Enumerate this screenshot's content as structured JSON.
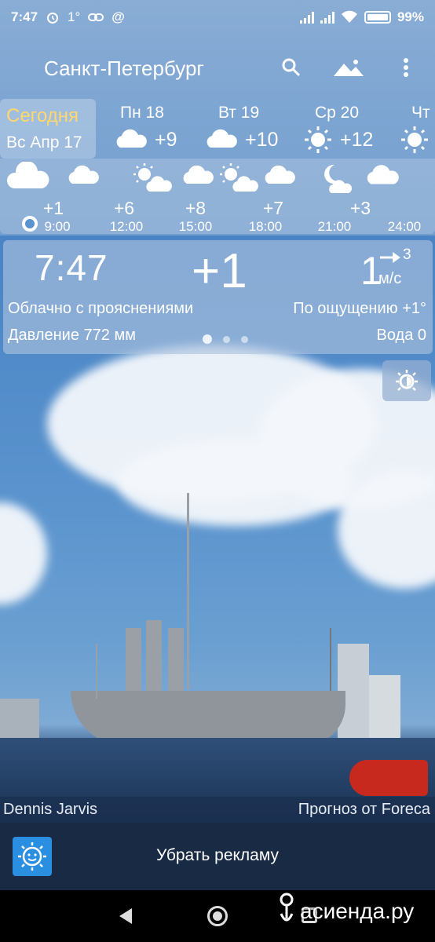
{
  "status_bar": {
    "time": "7:47",
    "notif_temp": "1°",
    "battery": "99%"
  },
  "toolbar": {
    "city": "Санкт-Петербург"
  },
  "daily": {
    "today_label": "Сегодня",
    "today_date": "Вс Апр 17",
    "days": [
      {
        "name": "Пн 18",
        "temp": "+9",
        "icon": "cloud-icon"
      },
      {
        "name": "Вт 19",
        "temp": "+10",
        "icon": "cloud-icon"
      },
      {
        "name": "Ср 20",
        "temp": "+12",
        "icon": "sun-icon"
      },
      {
        "name": "Чт",
        "temp": "",
        "icon": "sun-icon"
      }
    ]
  },
  "hourly": [
    {
      "temp": "+1",
      "time": "9:00",
      "icon": "cloud-icon"
    },
    {
      "temp": "+6",
      "time": "12:00",
      "icon": "partly-cloudy-icon"
    },
    {
      "temp": "+8",
      "time": "15:00",
      "icon": "partly-cloudy-icon"
    },
    {
      "temp": "+7",
      "time": "18:00",
      "icon": "cloud-icon"
    },
    {
      "temp": "+3",
      "time": "21:00",
      "icon": "moon-cloud-icon"
    },
    {
      "temp": "",
      "time": "24:00",
      "icon": "cloud-icon"
    }
  ],
  "current": {
    "time": "7:47",
    "temp": "+1",
    "wind_speed": "1",
    "wind_gust": "3",
    "wind_unit": "м/с",
    "description": "Облачно с прояснениями",
    "feels_like": "По ощущению +1°",
    "pressure": "Давление 772 мм",
    "water": "Вода 0"
  },
  "credits": {
    "photo_author": "Dennis Jarvis",
    "provider": "Прогноз от Foreca"
  },
  "ad": {
    "label": "Убрать рекламу"
  },
  "watermark": "асиенда.ру"
}
